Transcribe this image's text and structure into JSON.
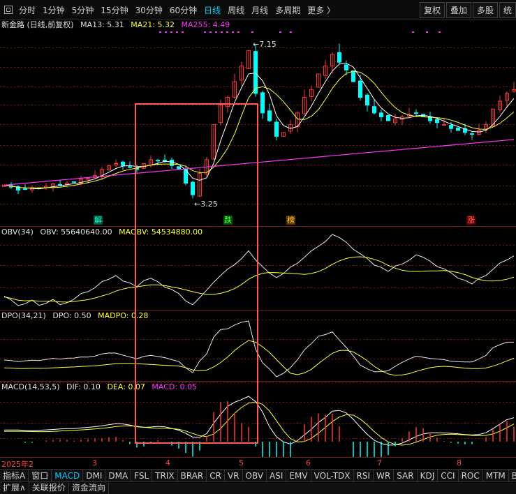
{
  "toolbar": {
    "timeframes": [
      "分时",
      "1分钟",
      "5分钟",
      "15分钟",
      "30分钟",
      "60分钟",
      "日线",
      "周线",
      "月线",
      "多周期",
      "更多 〉"
    ],
    "active": "日线",
    "right_buttons": [
      "复权",
      "叠加",
      "多股",
      "统"
    ]
  },
  "main": {
    "stock_title": "新金路 (日线,前复权)",
    "ma13": "MA13: 5.31",
    "ma21": "MA21: 5.32",
    "ma255": "MA255: 4.49",
    "high_label": "7.15",
    "low_label": "3.25",
    "markers": [
      {
        "text": "解",
        "color": "#00ffcc",
        "bg": "#005544"
      },
      {
        "text": "跌",
        "color": "#55ff55",
        "bg": "#005500"
      },
      {
        "text": "榜",
        "color": "#ffcc33",
        "bg": "#553300"
      },
      {
        "text": "涨",
        "color": "#ff6666",
        "bg": "#660000"
      }
    ]
  },
  "obv": {
    "title": "OBV(34)",
    "obv": "OBV: 55640640.00",
    "maobv": "MAOBV: 54534880.00"
  },
  "dpo": {
    "title": "DPO(34,21)",
    "dpo": "DPO: 0.50",
    "madpo": "MADPO: 0.28"
  },
  "macd": {
    "title": "MACD(14,53,5)",
    "dif": "DIF: 0.10",
    "dea": "DEA: 0.07",
    "macd": "MACD: 0.05"
  },
  "date_axis": [
    "2025年2",
    "3",
    "4",
    "5",
    "6",
    "7",
    "8"
  ],
  "tabs_row1": [
    "指标A",
    "窗口",
    "MACD",
    "DMI",
    "DMA",
    "FSL",
    "TRIX",
    "BRAR",
    "CR",
    "VR",
    "OBV",
    "ASI",
    "EMV",
    "VOL-TDX",
    "RSI",
    "WR",
    "SAR",
    "KDJ",
    "CCI",
    "ROC",
    "MTM",
    "BOLL"
  ],
  "tabs_row1_active": "MACD",
  "tabs_row2": [
    "扩展∧",
    "关联报价",
    "资金流向"
  ],
  "colors": {
    "up": "#ff3333",
    "down": "#00ffff",
    "ma13": "#ffffff",
    "ma21": "#ffff33",
    "ma255": "#ff33ff",
    "grid": "#7a1a1a"
  },
  "chart_data": {
    "type": "line",
    "candles_close_seq": [
      3.55,
      3.5,
      3.42,
      3.45,
      3.48,
      3.46,
      3.52,
      3.58,
      3.55,
      3.6,
      3.62,
      3.7,
      3.72,
      3.8,
      3.95,
      4.05,
      4.1,
      4.05,
      4.0,
      3.95,
      4.1,
      4.2,
      4.18,
      4.15,
      4.05,
      3.95,
      3.6,
      3.3,
      3.85,
      4.2,
      5.1,
      5.6,
      5.8,
      6.2,
      6.6,
      7.0,
      5.9,
      5.4,
      5.2,
      4.8,
      4.9,
      5.1,
      5.4,
      5.8,
      6.0,
      6.4,
      6.6,
      6.9,
      6.7,
      6.5,
      6.2,
      5.8,
      5.6,
      5.4,
      5.3,
      5.2,
      5.25,
      5.3,
      5.35,
      5.4,
      5.3,
      5.2,
      5.15,
      5.1,
      5.0,
      4.95,
      4.9,
      4.85,
      4.95,
      5.1,
      5.5,
      5.7,
      5.9,
      6.0
    ],
    "high": 7.15,
    "low": 3.25
  }
}
